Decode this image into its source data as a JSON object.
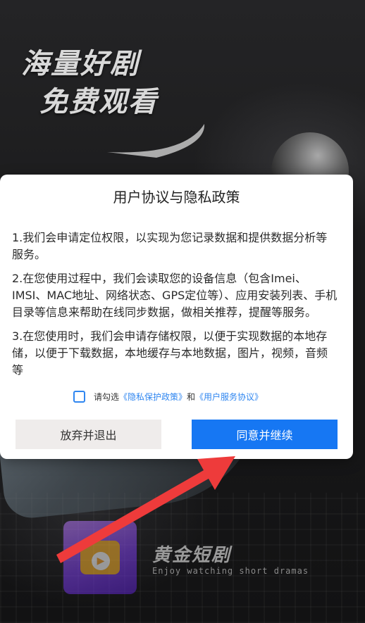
{
  "background": {
    "slogan_line1": "海量好剧",
    "slogan_line2": "免费观看",
    "brand_name": "黄金短剧",
    "brand_tagline": "Enjoy watching short dramas"
  },
  "dialog": {
    "title": "用户协议与隐私政策",
    "paragraphs": [
      "1.我们会申请定位权限，以实现为您记录数据和提供数据分析等服务。",
      "2.在您使用过程中，我们会读取您的设备信息（包含Imei、IMSI、MAC地址、网络状态、GPS定位等）、应用安装列表、手机目录等信息来帮助在线同步数据，做相关推荐，提醒等服务。",
      "3.在您使用时，我们会申请存储权限，以便于实现数据的本地存储，以便于下载数据，本地缓存与本地数据，图片，视频，音频等"
    ],
    "consent_prefix": "请勾选",
    "privacy_link": "《隐私保护政策》",
    "consent_and": "和",
    "terms_link": "《用户服务协议》",
    "checkbox_checked": false,
    "decline_label": "放弃并退出",
    "agree_label": "同意并继续"
  },
  "colors": {
    "accent": "#1677f3",
    "link": "#2f86f0",
    "arrow": "#ee3b3b"
  }
}
